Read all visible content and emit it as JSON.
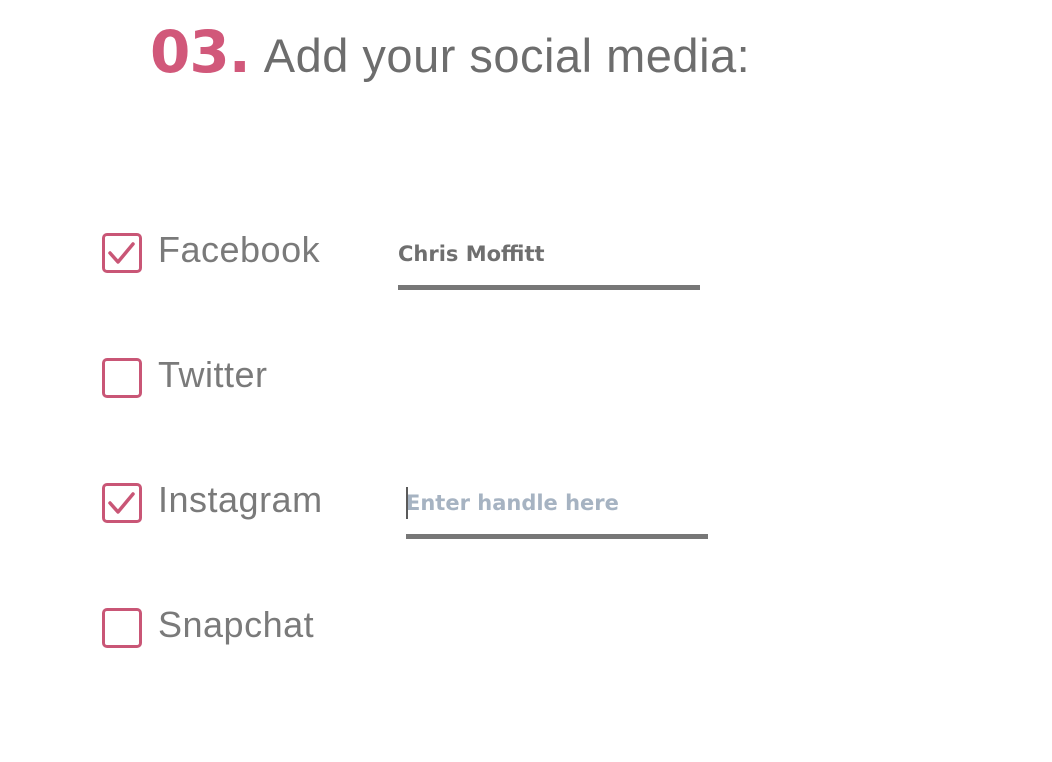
{
  "header": {
    "step_number": "03.",
    "title": "Add your social media:",
    "accent_color": "#d1587a"
  },
  "social_options": [
    {
      "label": "Facebook",
      "checked": true,
      "handle_value": "Chris Moffitt",
      "handle_placeholder": ""
    },
    {
      "label": "Twitter",
      "checked": false
    },
    {
      "label": "Instagram",
      "checked": true,
      "handle_value": "",
      "handle_placeholder": "Enter handle here"
    },
    {
      "label": "Snapchat",
      "checked": false
    }
  ],
  "icons": {
    "check": "checkmark-icon"
  }
}
